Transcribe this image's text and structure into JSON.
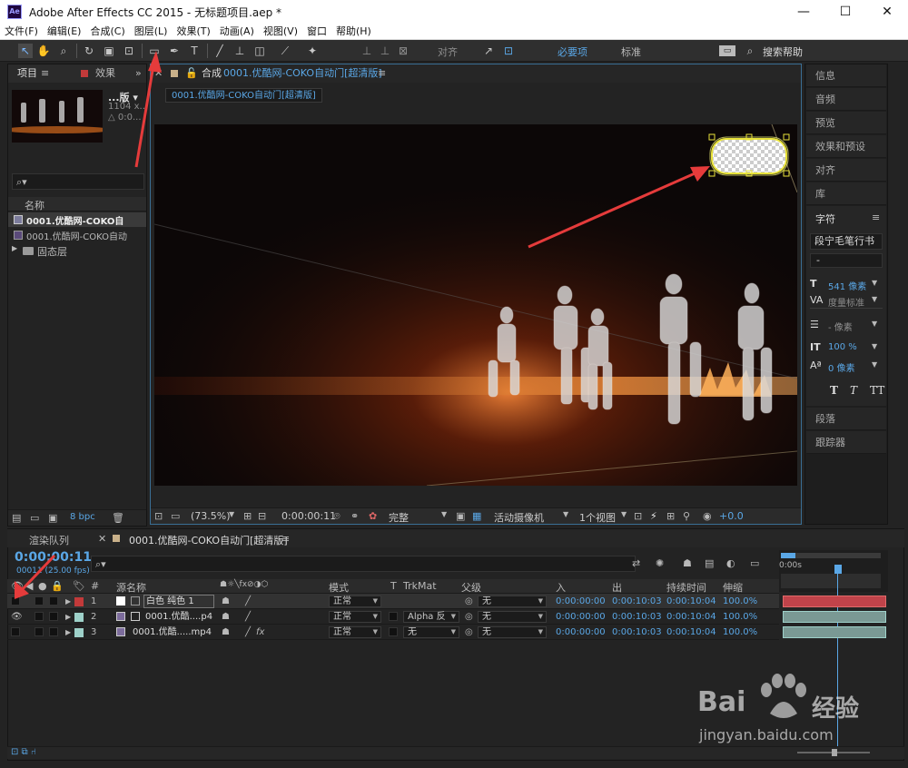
{
  "app": {
    "logo": "Ae",
    "title": "Adobe After Effects CC 2015 - 无标题项目.aep *",
    "window_controls": [
      "—",
      "☐",
      "✕"
    ]
  },
  "menu": [
    "文件(F)",
    "编辑(E)",
    "合成(C)",
    "图层(L)",
    "效果(T)",
    "动画(A)",
    "视图(V)",
    "窗口",
    "帮助(H)"
  ],
  "toolbar": {
    "align_label": "对齐",
    "workspace_primary": "必要项",
    "workspace_secondary": "标准",
    "search_label": "搜索帮助"
  },
  "project_panel": {
    "tab": "项目",
    "effects_tab": "效果",
    "thumb_name": "...版 ▾",
    "thumb_size": "1104 x...",
    "thumb_delta": "△ 0:0...",
    "search_placeholder": "⌕▾",
    "name_header": "名称",
    "items": [
      {
        "name": "0001.优酷网-COKO自",
        "type": "comp"
      },
      {
        "name": "0001.优酷网-COKO自动",
        "type": "footage"
      },
      {
        "name": "固态层",
        "type": "folder"
      }
    ],
    "bpc": "8 bpc"
  },
  "comp_panel": {
    "tab_prefix": "合成",
    "tab_name": "0001.优酷网-COKO自动门[超清版]",
    "breadcrumb": "0001.优酷网-COKO自动门[超清版]",
    "zoom": "(73.5%)",
    "timecode": "0:00:00:11",
    "quality": "完整",
    "camera": "活动摄像机",
    "views": "1个视图",
    "exposure": "+0.0"
  },
  "right_panel": {
    "items_top": [
      "信息",
      "音频",
      "预览",
      "效果和预设",
      "对齐",
      "库"
    ],
    "char_tab": "字符",
    "font": "段宁毛笔行书",
    "font_style": "-",
    "size_value": "541 像素",
    "tracking_label": "度量标准",
    "leading_value": "- 像素",
    "vscale_value": "100 %",
    "baseline_value": "0 像素",
    "style_buttons": [
      "T",
      "T",
      "TT"
    ],
    "items_bottom": [
      "段落",
      "跟踪器"
    ]
  },
  "timeline": {
    "render_tab": "渲染队列",
    "comp_tab": "0001.优酷网-COKO自动门[超清版]",
    "timecode": "0:00:00:11",
    "fps": "00011 (25.00 fps)",
    "search_placeholder": "⌕▾",
    "ruler_start": "0:00s",
    "headers": {
      "hash": "#",
      "source": "源名称",
      "mode": "模式",
      "t": "T",
      "trkmat": "TrkMat",
      "parent": "父级",
      "in": "入",
      "out": "出",
      "duration": "持续时间",
      "stretch": "伸缩"
    },
    "layers": [
      {
        "num": "1",
        "name": "白色 纯色 1",
        "mode": "正常",
        "trkmat": "",
        "parent": "无",
        "in": "0:00:00:00",
        "out": "0:00:10:03",
        "duration": "0:00:10:04",
        "stretch": "100.0%",
        "label_color": "#c23a3a"
      },
      {
        "num": "2",
        "name": "0001.优酷....p4",
        "mode": "正常",
        "trkmat": "Alpha 反",
        "parent": "无",
        "in": "0:00:00:00",
        "out": "0:00:10:03",
        "duration": "0:00:10:04",
        "stretch": "100.0%",
        "label_color": "#9ed1c9"
      },
      {
        "num": "3",
        "name": "0001.优酷.....mp4",
        "mode": "正常",
        "trkmat": "无",
        "parent": "无",
        "in": "0:00:00:00",
        "out": "0:00:10:03",
        "duration": "0:00:10:04",
        "stretch": "100.0%",
        "label_color": "#9ed1c9"
      }
    ]
  },
  "watermark": {
    "brand": "Bai",
    "brand_cn": "经验",
    "url": "jingyan.baidu.com"
  },
  "colors": {
    "accent": "#5aa7e6",
    "arrow": "#e53b3b",
    "label_red": "#c23a3a",
    "label_teal": "#9ed1c9"
  }
}
